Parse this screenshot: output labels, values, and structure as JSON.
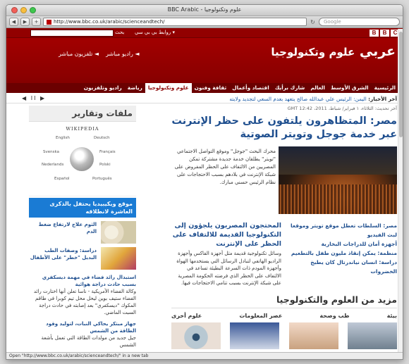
{
  "window": {
    "title": "BBC Arabic - علوم وتكنولوجيا"
  },
  "toolbar": {
    "back": "◀",
    "forward": "▶",
    "add": "+",
    "url": "http://www.bbc.co.uk/arabic/scienceandtech/",
    "reload": "↻",
    "search_placeholder": "Google"
  },
  "bbc": {
    "logo": [
      "B",
      "B",
      "C"
    ],
    "search_button": "بحث",
    "top_links": "روابط بي بي سي ▾",
    "brand_main": "عربي",
    "brand_section": "علوم وتكنولوجيا",
    "live_radio": "◄ راديو مباشر",
    "live_tv": "◄ تلفزيون مباشر"
  },
  "nav": [
    {
      "label": "الرئيسية",
      "active": false
    },
    {
      "label": "الشرق الأوسط",
      "active": false
    },
    {
      "label": "العالم",
      "active": false
    },
    {
      "label": "شارك برأيك",
      "active": false
    },
    {
      "label": "اقتصاد وأعمال",
      "active": false
    },
    {
      "label": "ثقافة وفنون",
      "active": false
    },
    {
      "label": "علوم وتكنولوجيا",
      "active": true
    },
    {
      "label": "رياضة",
      "active": false
    },
    {
      "label": "راديو وتلفزيون",
      "active": false
    }
  ],
  "ticker": {
    "label": "آخر الأخبار:",
    "text": "اليمن: الرئيس علي عبدالله صالح يتعهد بعدم السعي لتجديد ولايته",
    "controls": "▶ II ◀"
  },
  "updated": "آخر تحديث: الثلاثاء، ١ فبراير/ شباط، 2011، GMT 12:42",
  "main": {
    "headline": "مصر: المتظاهرون يلتفون على حظر الإنترنت عبر خدمة جوجل وتويتر الصوتية",
    "summary": "محرك البحث \"جوجل\" وموقع التواصل الاجتماعي \"تويتر\" يطلقان خدمة جديدة مشتركة تمكن المصريين من الالتفاف على الحظر المفروض على شبكة الإنترنت في بلادهم بسبب الاحتجاجات على نظام الرئيس حسني مبارك.",
    "second_title": "المحتجون المصريون يلجؤون إلى التكنولوجيا القديمة للالتفاف على الحظر على الإنترنت",
    "second_text": "وسائل تكنولوجية قديمة مثل أجهزة الفاكس وأجهزة الراديو الهاتفي لتبادل الرسائل التي يستخدمها الهواة وأجهزة المودم ذات السرعة البطيئة تساعد في الالتفاف على الحظر الذي فرضته الحكومة المصرية على شبكة الإنترنت بسبب تنامي الاحتجاجات فيها.",
    "links": [
      "مصر: السلطات تعطل موقع تويتر وموقعا لبث الفيديو",
      "أجهزة أمان للدراجات البخارية",
      "منظمة: يمكن إنقاذ مليون طفل بالتطعيم",
      "دراسة: انسان نياندرتال كان يطبخ الخضروات"
    ],
    "more_title": "مزيد من العلوم والتكنولوجيا",
    "categories": [
      "بيئة",
      "طب وصحة",
      "عصر المعلومات",
      "علوم أخرى"
    ]
  },
  "sidebar": {
    "title": "ملفات وتقارير",
    "wiki_name": "WIKIPEDIA",
    "wiki_langs": [
      "English",
      "Deutsch",
      "Français",
      "Polski",
      "Nederlands",
      "Svenska",
      "Español",
      "Português"
    ],
    "blue_title": "موقع ويكيبيديا يحتفل بالذكرى العاشرة لانطلاقه",
    "item1": "الثوم علاج لارتفاع ضغط الدم",
    "item2": "دراسة: وصفات الطب البديل \"خطر\" على الأطفال",
    "story_title": "استبدال رائد فضاء في مهمة ديسكفري بسبب حادث دراجة هوائية",
    "story_text": "وكالة الفضاء الأمريكية - ناسا تعلن أنها اختارت رائد الفضاء ستيف بوين ليحل محل تيم كوبرا في طاقم المكوك \"ديسكفري\" بعد إصابته في حادث دراجة السبت الماضي.",
    "story2_title": "جهاز مبتكر يحاكي النبات، لتوليد وقود الطاقة من الشمس",
    "story2_text": "جيل جديد من مولدات الطاقة التي تعمل بأشعة الشمس"
  },
  "status": "Open \"http://www.bbc.co.uk/arabic/scienceandtech/\" in a new tab"
}
